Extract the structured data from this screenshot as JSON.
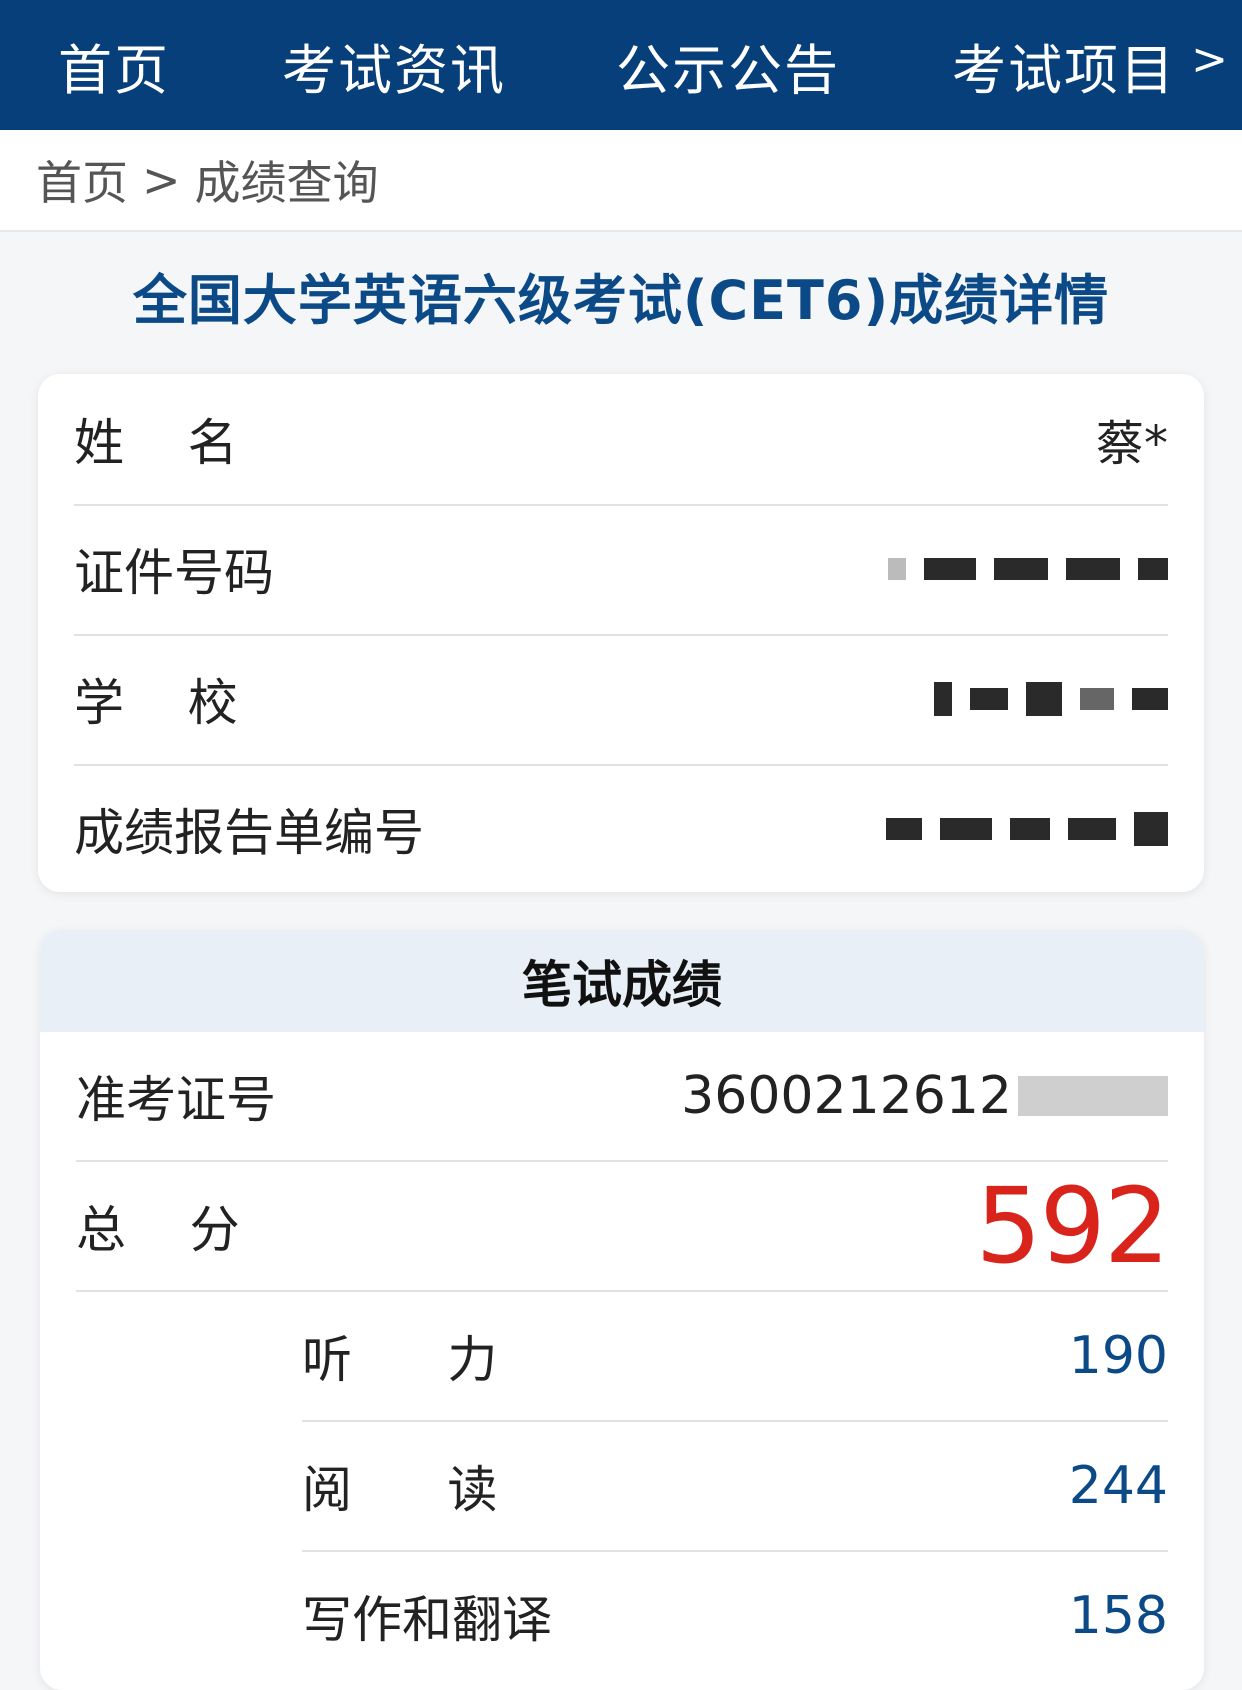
{
  "nav": {
    "items": [
      "首页",
      "考试资讯",
      "公示公告",
      "考试项目"
    ],
    "more": ">"
  },
  "breadcrumb": {
    "home": "首页",
    "sep": ">",
    "current": "成绩查询"
  },
  "title": "全国大学英语六级考试(CET6)成绩详情",
  "info": {
    "name_label": "姓    名",
    "name_value": "蔡*",
    "id_label": "证件号码",
    "school_label": "学    校",
    "report_label": "成绩报告单编号"
  },
  "written": {
    "header": "笔试成绩",
    "ticket_label": "准考证号",
    "ticket_value": "3600212612",
    "total_label": "总    分",
    "total_value": "592",
    "listening_label": "听      力",
    "listening_value": "190",
    "reading_label": "阅      读",
    "reading_value": "244",
    "writing_label": "写作和翻译",
    "writing_value": "158"
  },
  "colors": {
    "nav_bg": "#073f7a",
    "title": "#0b4a86",
    "total_score": "#d9241c",
    "sub_score": "#0b4a86"
  }
}
